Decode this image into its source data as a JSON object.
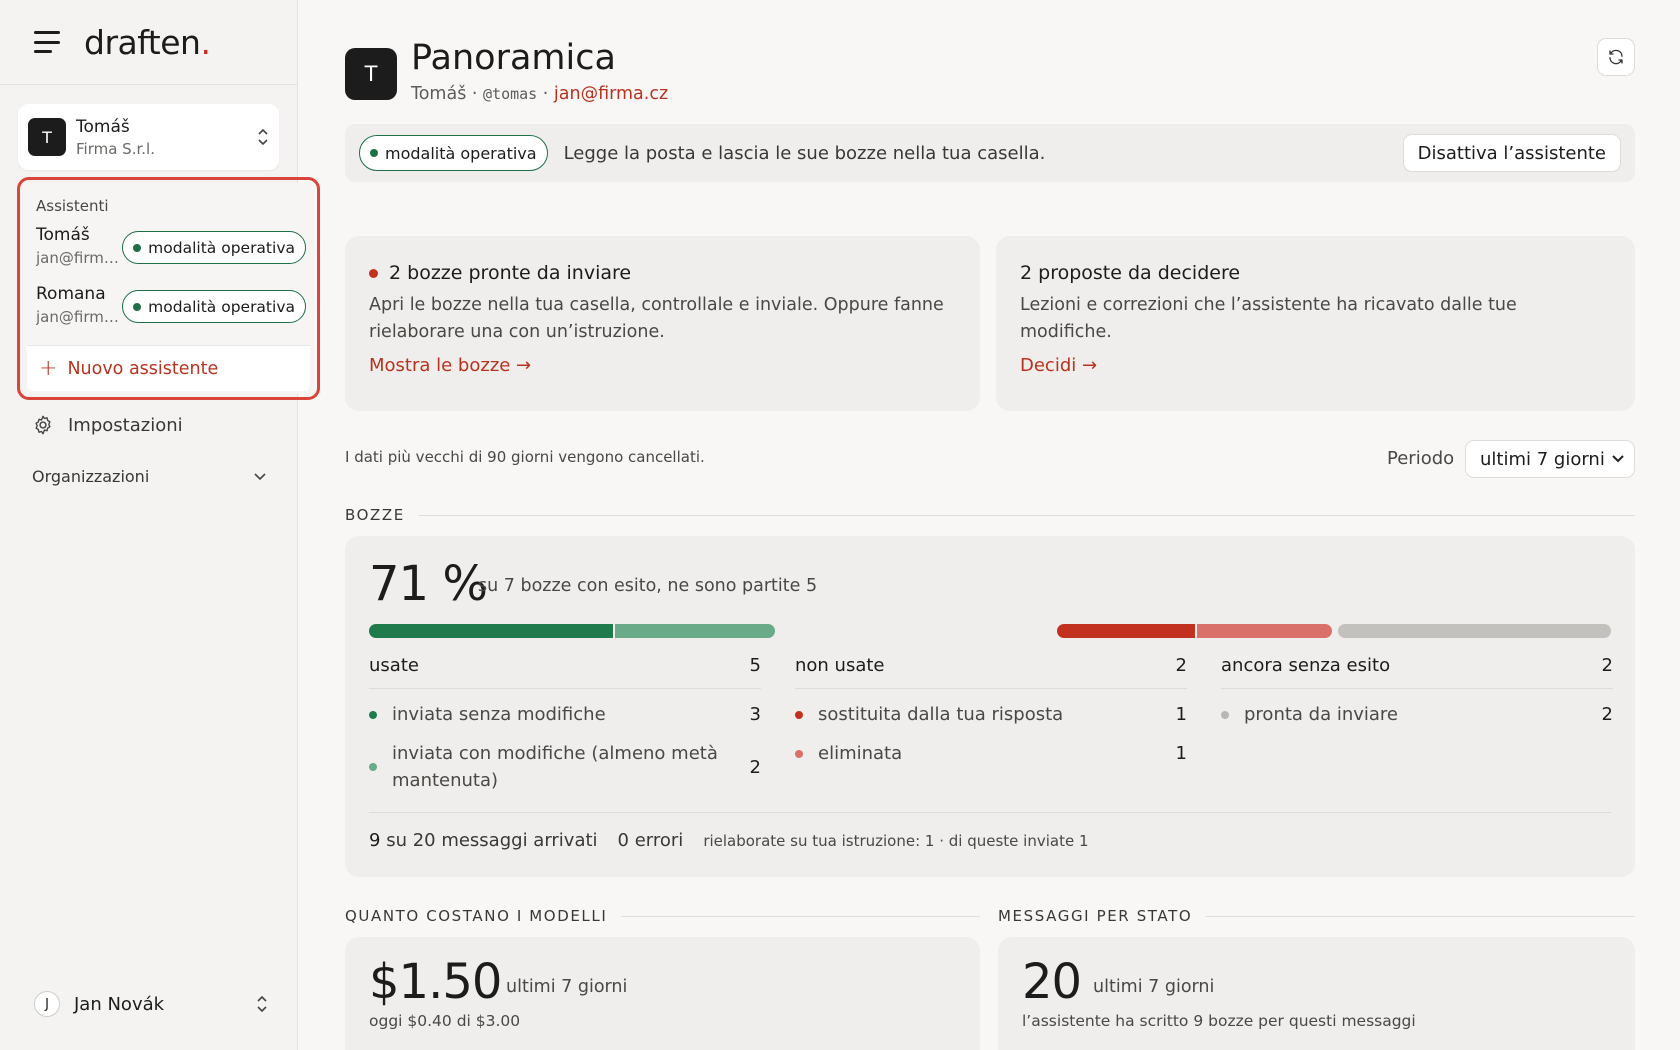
{
  "brand": {
    "name": "draften",
    "dot": "."
  },
  "account": {
    "initial": "T",
    "name": "Tomáš",
    "org": "Firma S.r.l."
  },
  "assistants": {
    "title": "Assistenti",
    "items": [
      {
        "name": "Tomáš",
        "email": "jan@firma...",
        "status": "modalità operativa"
      },
      {
        "name": "Romana",
        "email": "jan@firma...",
        "status": "modalità operativa"
      }
    ],
    "new_label": "Nuovo assistente"
  },
  "nav": {
    "settings": "Impostazioni",
    "organizations": "Organizzazioni"
  },
  "user": {
    "initial": "J",
    "name": "Jan Novák"
  },
  "page": {
    "avatar": "T",
    "title": "Panoramica",
    "sub_name": "Tomáš",
    "sub_sep1": " · ",
    "sub_handle": "@tomas",
    "sub_sep2": " · ",
    "sub_email": "jan@firma.cz"
  },
  "status_bar": {
    "pill": "modalità operativa",
    "text": "Legge la posta e lascia le sue bozze nella tua casella.",
    "button": "Disattiva l’assistente"
  },
  "cards": {
    "drafts": {
      "title": "2 bozze pronte da inviare",
      "body": "Apri le bozze nella tua casella, controllale e inviale. Oppure fanne rielaborare una con un’istruzione.",
      "link": "Mostra le bozze →"
    },
    "proposals": {
      "title": "2 proposte da decidere",
      "body": "Lezioni e correzioni che l’assistente ha ricavato dalle tue modifiche.",
      "link": "Decidi →"
    }
  },
  "retention_note": "I dati più vecchi di 90 giorni vengono cancellati.",
  "period": {
    "label": "Periodo",
    "selected": "ultimi 7 giorni"
  },
  "drafts_section": {
    "heading": "BOZZE",
    "percent": "71 %",
    "percent_sub": "su 7 bozze con esito, ne sono partite 5",
    "bar_segments": [
      {
        "group": "usate",
        "color": "#1f7a4c",
        "value": 3
      },
      {
        "group": "usate",
        "color": "#6aaa88",
        "value": 2
      },
      {
        "group": "non usate",
        "color": "#c2311f",
        "value": 1
      },
      {
        "group": "non usate",
        "color": "#d9706a",
        "value": 1
      },
      {
        "group": "ancora senza esito",
        "color": "#c3c1be",
        "value": 2
      }
    ],
    "columns": [
      {
        "title": "usate",
        "total": "5",
        "rows": [
          {
            "label": "inviata senza modifiche",
            "value": "3",
            "color": "#1f7a4c"
          },
          {
            "label": "inviata con modifiche (almeno metà mantenuta)",
            "value": "2",
            "color": "#6aaa88"
          }
        ]
      },
      {
        "title": "non usate",
        "total": "2",
        "rows": [
          {
            "label": "sostituita dalla tua risposta",
            "value": "1",
            "color": "#c2311f"
          },
          {
            "label": "eliminata",
            "value": "1",
            "color": "#d9706a"
          }
        ]
      },
      {
        "title": "ancora senza esito",
        "total": "2",
        "rows": [
          {
            "label": "pronta da inviare",
            "value": "2",
            "color": "#b9b7b4"
          }
        ]
      }
    ],
    "footer": {
      "arrived_num": "9",
      "arrived_text": "su 20 messaggi arrivati",
      "errors": "0 errori",
      "reworked": "rielaborate su tua istruzione: 1 · di queste inviate 1"
    }
  },
  "cost_section": {
    "heading": "QUANTO COSTANO I MODELLI",
    "value": "$1.50",
    "period": "ultimi 7 giorni",
    "note": "oggi $0.40 di $3.00"
  },
  "messages_section": {
    "heading": "MESSAGGI PER STATO",
    "value": "20",
    "period": "ultimi 7 giorni",
    "note": "l’assistente ha scritto 9 bozze per questi messaggi"
  }
}
